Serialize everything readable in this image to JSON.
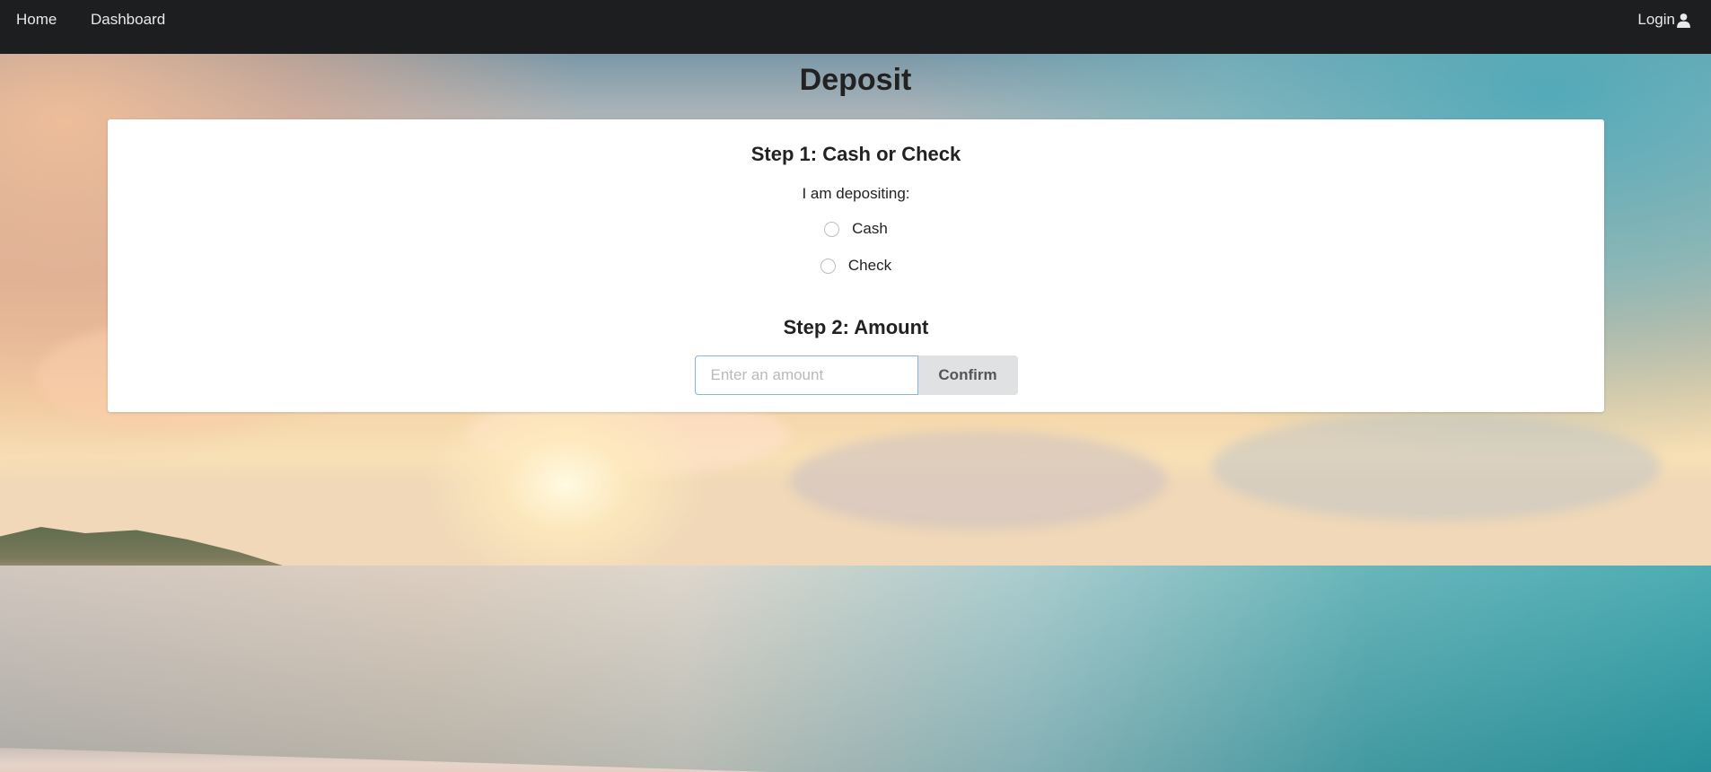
{
  "navbar": {
    "home_label": "Home",
    "dashboard_label": "Dashboard",
    "login_label": "Login",
    "login_icon": "user-icon"
  },
  "page": {
    "title": "Deposit"
  },
  "step1": {
    "title": "Step 1: Cash or Check",
    "prompt": "I am depositing:",
    "options": [
      "Cash",
      "Check"
    ],
    "selected": null
  },
  "step2": {
    "title": "Step 2: Amount",
    "amount_value": "",
    "amount_placeholder": "Enter an amount",
    "confirm_label": "Confirm"
  },
  "colors": {
    "navbar_bg": "#1d1e20",
    "card_bg": "#ffffff",
    "input_border": "#85b7d9",
    "button_bg": "#e0e1e2"
  }
}
